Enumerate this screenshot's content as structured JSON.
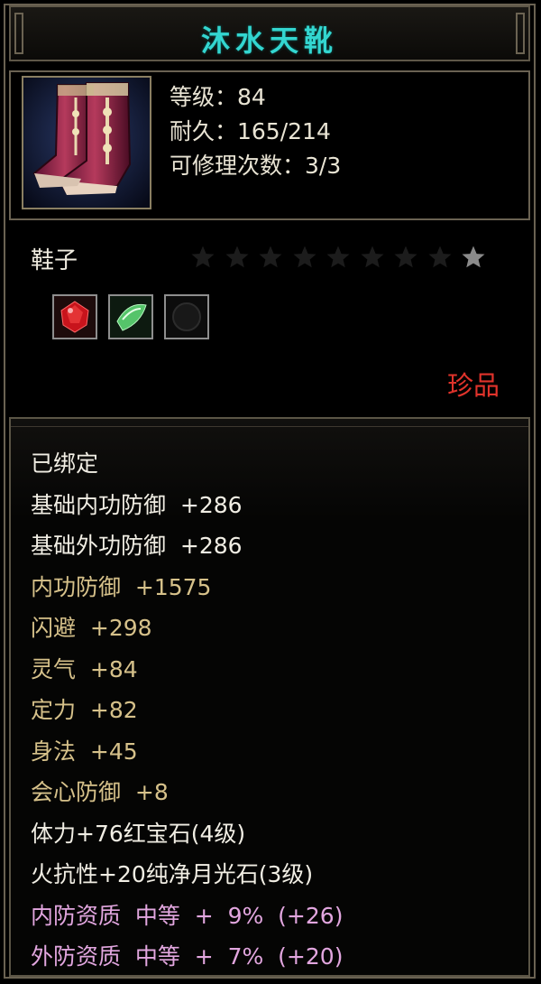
{
  "item": {
    "name": "沐水天靴",
    "level": "等级：84",
    "durability": "耐久：165/214",
    "repairs": "可修理次数：3/3",
    "type": "鞋子",
    "rarity": "珍品",
    "star_count": 9,
    "stars_filled": 1,
    "gems": [
      {
        "name": "ruby-gem-icon",
        "color": "#d8232a"
      },
      {
        "name": "moonstone-gem-icon",
        "color": "#5fd07a"
      },
      {
        "name": "empty-gem-slot",
        "color": "#1a1a1a"
      }
    ]
  },
  "attributes": [
    {
      "text": "已绑定",
      "color": "white"
    },
    {
      "text": "基础内功防御  +286",
      "color": "white"
    },
    {
      "text": "基础外功防御  +286",
      "color": "white"
    },
    {
      "text": "内功防御  +1575",
      "color": "gold"
    },
    {
      "text": "闪避  +298",
      "color": "gold"
    },
    {
      "text": "灵气  +84",
      "color": "gold"
    },
    {
      "text": "定力  +82",
      "color": "gold"
    },
    {
      "text": "身法  +45",
      "color": "gold"
    },
    {
      "text": "会心防御  +8",
      "color": "gold"
    },
    {
      "text": "体力+76红宝石(4级)",
      "color": "white"
    },
    {
      "text": "火抗性+20纯净月光石(3级)",
      "color": "white"
    },
    {
      "text": "内防资质  中等  +  9%  (+26)",
      "color": "pink"
    },
    {
      "text": "外防资质  中等  +  7%  (+20)",
      "color": "pink"
    }
  ]
}
